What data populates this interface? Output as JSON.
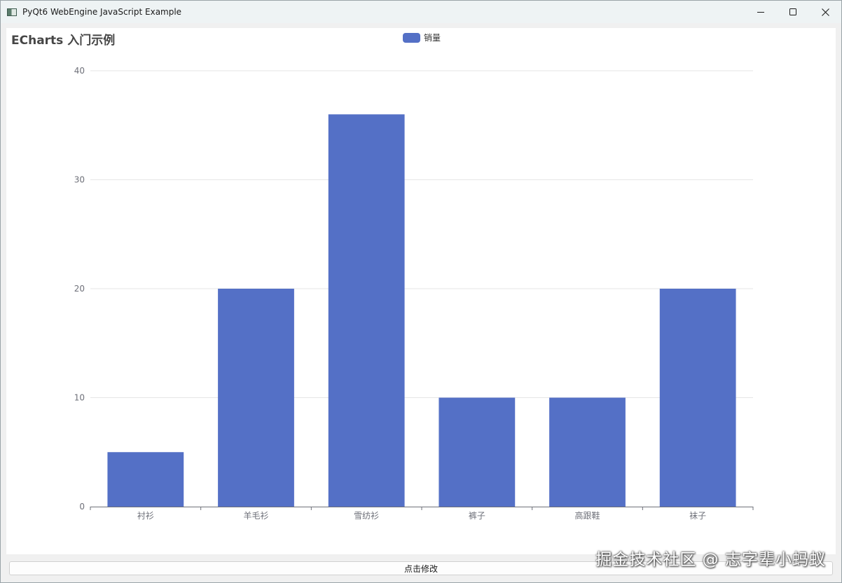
{
  "window": {
    "title": "PyQt6 WebEngine JavaScript Example"
  },
  "icons": [
    "app-icon",
    "minimize-icon",
    "maximize-icon",
    "close-icon"
  ],
  "chart_data": {
    "type": "bar",
    "title": "ECharts 入门示例",
    "legend": [
      "销量"
    ],
    "legend_placement": "top-center",
    "categories": [
      "衬衫",
      "羊毛衫",
      "雪纺衫",
      "裤子",
      "高跟鞋",
      "袜子"
    ],
    "series": [
      {
        "name": "销量",
        "values": [
          5,
          20,
          36,
          10,
          10,
          20
        ],
        "color": "#5470c6"
      }
    ],
    "yticks": [
      "0",
      "10",
      "20",
      "30",
      "40"
    ],
    "ylim": [
      0,
      40
    ],
    "grid": true
  },
  "button": {
    "label": "点击修改"
  },
  "watermark": "掘金技术社区 @ 志字辈小蚂蚁"
}
